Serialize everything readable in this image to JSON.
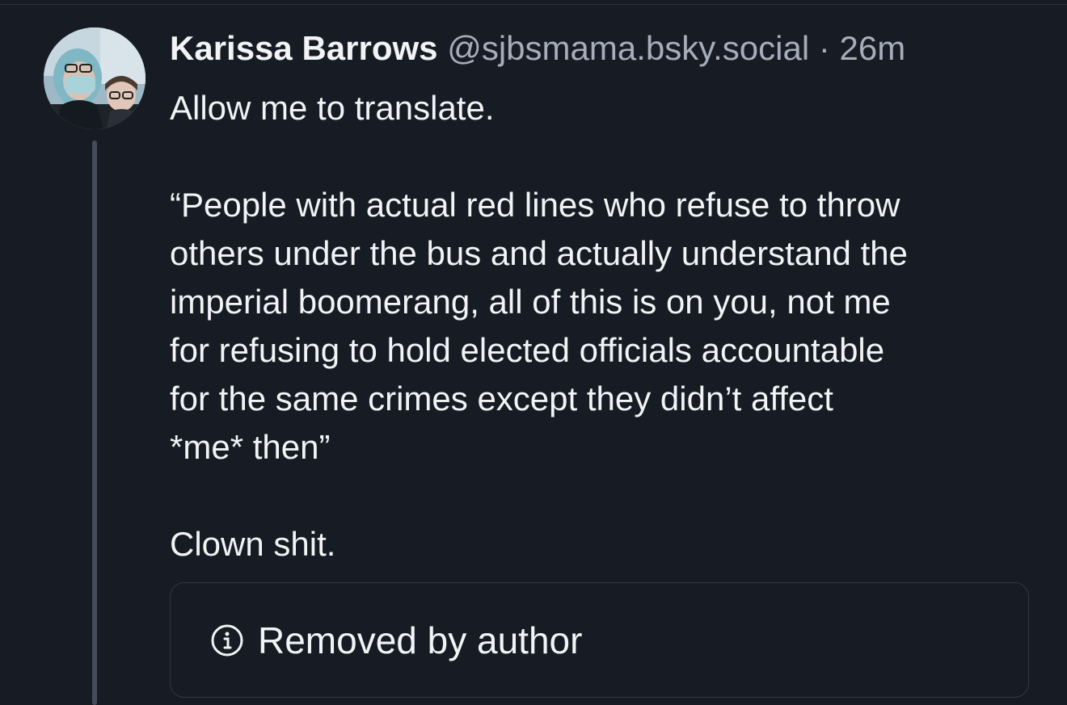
{
  "post": {
    "author_name": "Karissa Barrows",
    "author_handle": "@sjbsmama.bsky.social",
    "separator": "·",
    "time": "26m",
    "text": "Allow me to translate.\n\n“People with actual red lines who refuse to throw\nothers under the bus and actually understand the\nimperial boomerang, all of this is on you, not me\nfor refusing to hold elected officials accountable\nfor the same crimes except they didn’t affect\n*me* then”\n\nClown shit."
  },
  "quoted_post": {
    "icon": "info-circle-icon",
    "status_text": "Removed by author"
  },
  "colors": {
    "background": "#171c24",
    "text_primary": "#f1f3f5",
    "text_secondary": "#a6aebb",
    "border": "#313844",
    "thread_line": "#444c5c"
  }
}
